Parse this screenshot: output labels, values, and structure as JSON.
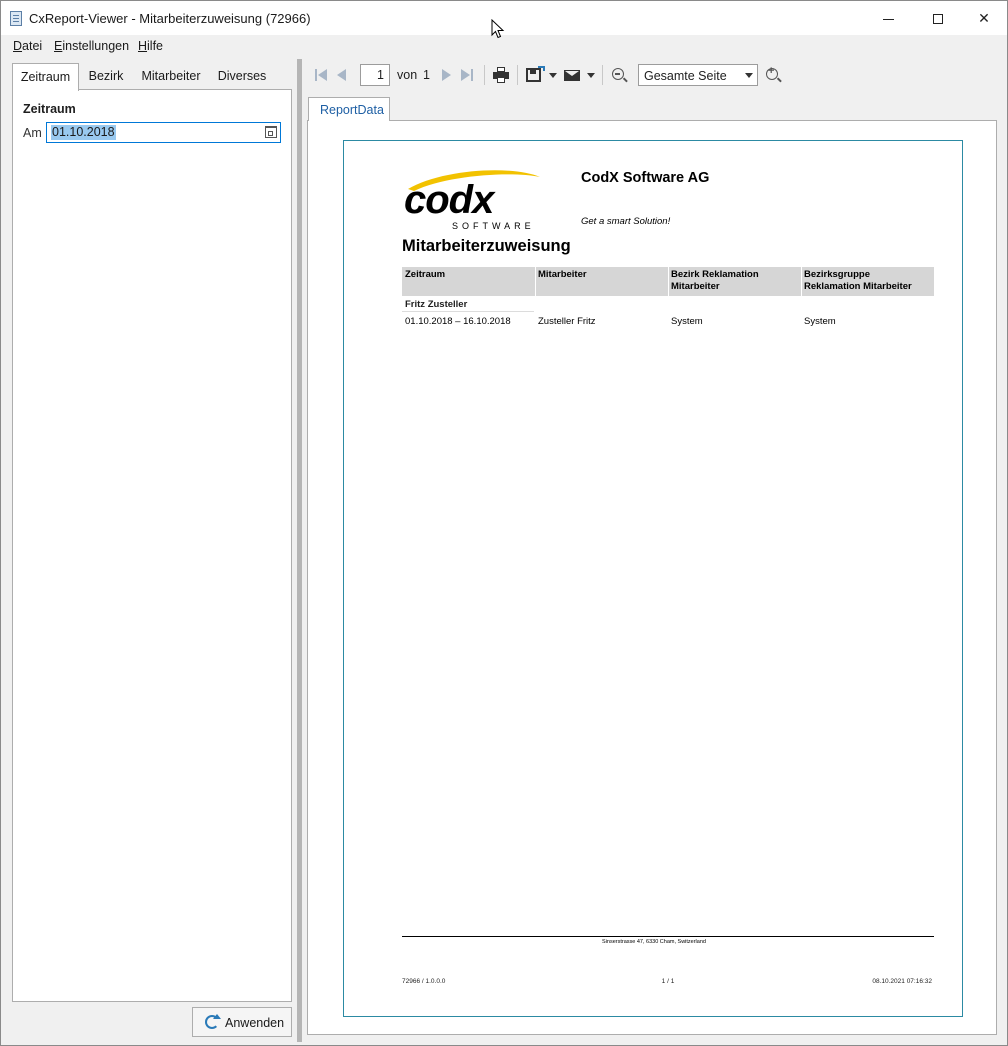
{
  "window": {
    "title": "CxReport-Viewer - Mitarbeiterzuweisung (72966)"
  },
  "menu": {
    "items": [
      {
        "accel": "D",
        "rest": "atei"
      },
      {
        "accel": "E",
        "rest": "instellungen"
      },
      {
        "accel": "H",
        "rest": "ilfe"
      }
    ]
  },
  "filter_tabs": [
    "Zeitraum",
    "Bezirk",
    "Mitarbeiter",
    "Diverses"
  ],
  "filter_panel": {
    "section_title": "Zeitraum",
    "date_label": "Am",
    "date_value": "01.10.2018"
  },
  "apply_button": {
    "label": "Anwenden"
  },
  "toolbar": {
    "page_current": "1",
    "page_of_label": "von",
    "page_total": "1",
    "zoom_value": "Gesamte Seite"
  },
  "report_tab": {
    "label": "ReportData"
  },
  "report": {
    "logo_text": "codx",
    "logo_sub": "SOFTWARE",
    "company": "CodX Software AG",
    "tagline": "Get a smart Solution!",
    "title": "Mitarbeiterzuweisung",
    "columns": [
      {
        "line1": "Zeitraum",
        "line2": ""
      },
      {
        "line1": "Mitarbeiter",
        "line2": ""
      },
      {
        "line1": "Bezirk Reklamation",
        "line2": "Mitarbeiter"
      },
      {
        "line1": "Bezirksgruppe",
        "line2": "Reklamation Mitarbeiter"
      }
    ],
    "group": "Fritz Zusteller",
    "rows": [
      [
        "01.10.2018 – 16.10.2018",
        "Zusteller  Fritz",
        "System",
        "System"
      ]
    ],
    "address": "Sinserstrasse 47,  6330 Cham,  Switzerland",
    "footer_left": "72966 / 1.0.0.0",
    "footer_mid": "1 / 1",
    "footer_right": "08.10.2021 07:16:32"
  },
  "colors": {
    "accent": "#0078d7",
    "selection": "#99c9ef",
    "logo_yellow": "#f2c200",
    "page_border": "#2c8aa3",
    "table_header": "#d6d6d6"
  }
}
